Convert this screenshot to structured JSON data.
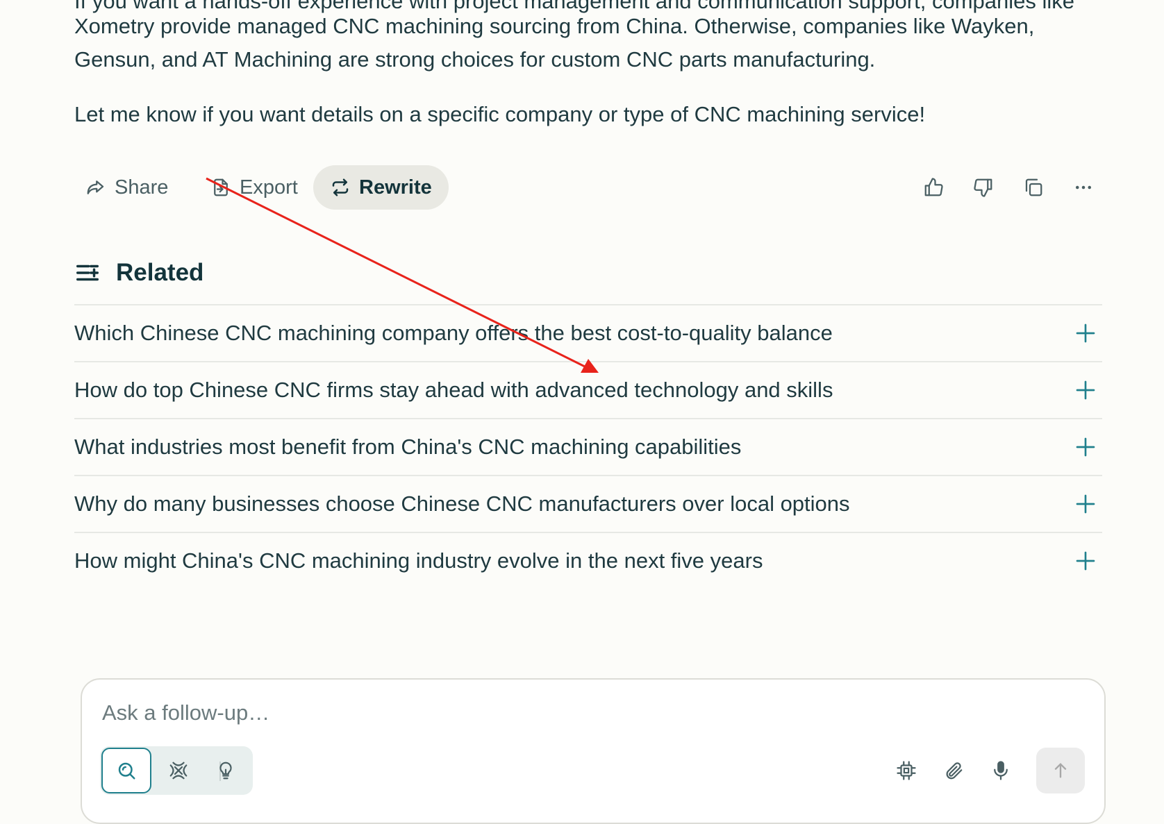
{
  "answer": {
    "cut_line": "If you want a hands-off experience with project management and communication support, companies like",
    "paragraph_1": "Xometry provide managed CNC machining sourcing from China. Otherwise, companies like Wayken, Gensun, and AT Machining are strong choices for custom CNC parts manufacturing.",
    "paragraph_2": "Let me know if you want details on a specific company or type of CNC machining service!"
  },
  "actions": {
    "share_label": "Share",
    "export_label": "Export",
    "rewrite_label": "Rewrite",
    "icons": [
      "thumbs-up-icon",
      "thumbs-down-icon",
      "copy-icon",
      "more-icon"
    ]
  },
  "related": {
    "title": "Related",
    "items": [
      {
        "label": "Which Chinese CNC machining company offers the best cost-to-quality balance"
      },
      {
        "label": "How do top Chinese CNC firms stay ahead with advanced technology and skills"
      },
      {
        "label": "What industries most benefit from China's CNC machining capabilities"
      },
      {
        "label": "Why do many businesses choose Chinese CNC manufacturers over local options"
      },
      {
        "label": "How might China's CNC machining industry evolve in the next five years"
      }
    ]
  },
  "composer": {
    "placeholder": "Ask a follow-up…",
    "value": "",
    "modes": [
      "search",
      "research",
      "labs"
    ],
    "selected_mode": "search"
  },
  "colors": {
    "background": "#fcfcf9",
    "text": "#13343b",
    "accent": "#20808d",
    "annotation_arrow": "#e8231b"
  }
}
